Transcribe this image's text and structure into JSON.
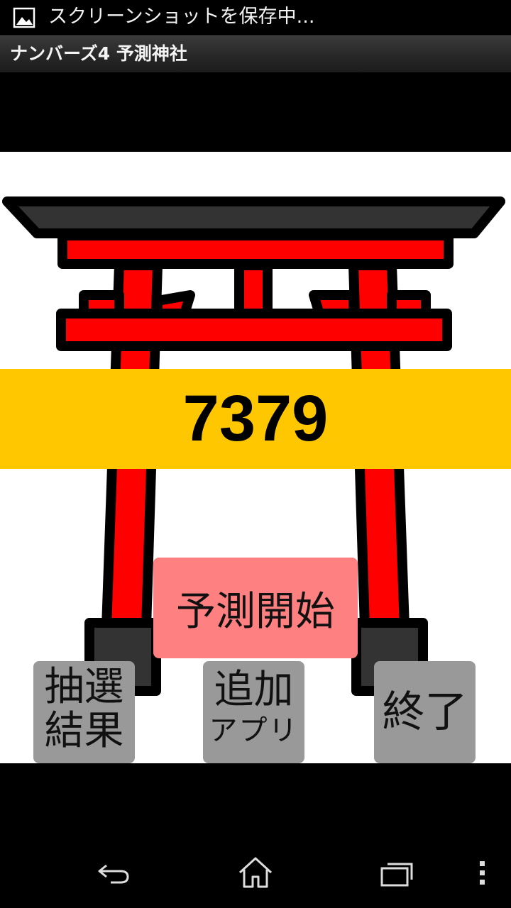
{
  "status_bar": {
    "notification_icon": "image-icon",
    "text": "スクリーンショットを保存中..."
  },
  "title_bar": {
    "title": "ナンバーズ4 予測神社"
  },
  "main": {
    "background_image": "torii-gate",
    "prediction_number": "7379",
    "colors": {
      "number_band": "#ffc700",
      "predict_button": "#ff8080",
      "gray_buttons": "#999999",
      "torii_red": "#ff0000"
    },
    "predict_button": "予測開始",
    "buttons": {
      "results_line1": "抽選",
      "results_line2": "結果",
      "add_line1": "追加",
      "add_line2": "アプリ",
      "exit": "終了"
    }
  },
  "nav_bar": {
    "back_icon": "back-icon",
    "home_icon": "home-icon",
    "recent_icon": "recent-apps-icon",
    "menu_icon": "overflow-menu-icon"
  }
}
